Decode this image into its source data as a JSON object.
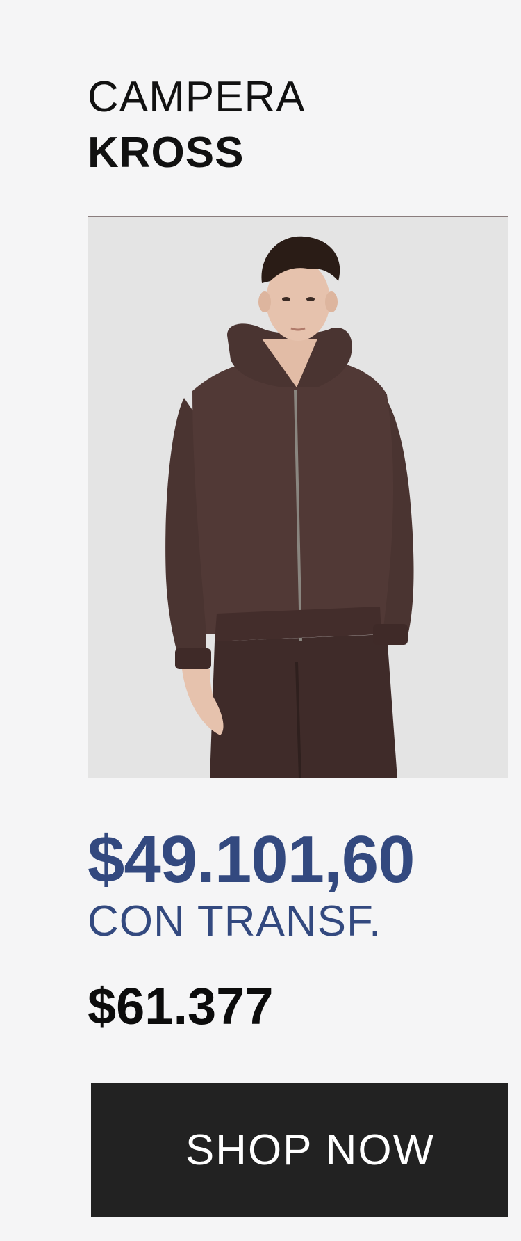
{
  "product": {
    "title_line1": "CAMPERA",
    "title_line2": "KROSS",
    "image": {
      "subject": "model-wearing-brown-hooded-zip-jacket",
      "colors": {
        "background": "#e4e4e4",
        "garment": "#4a3431",
        "hair": "#2a1c16",
        "skin": "#e6c2ad"
      }
    },
    "price_transfer": "$49.101,60",
    "transfer_label": "CON TRANSF.",
    "price_regular": "$61.377",
    "cta_label": "SHOP NOW"
  },
  "theme": {
    "page_bg": "#f5f5f6",
    "accent": "#33497f",
    "text": "#111111",
    "button_bg": "#222222",
    "button_text": "#ffffff"
  }
}
